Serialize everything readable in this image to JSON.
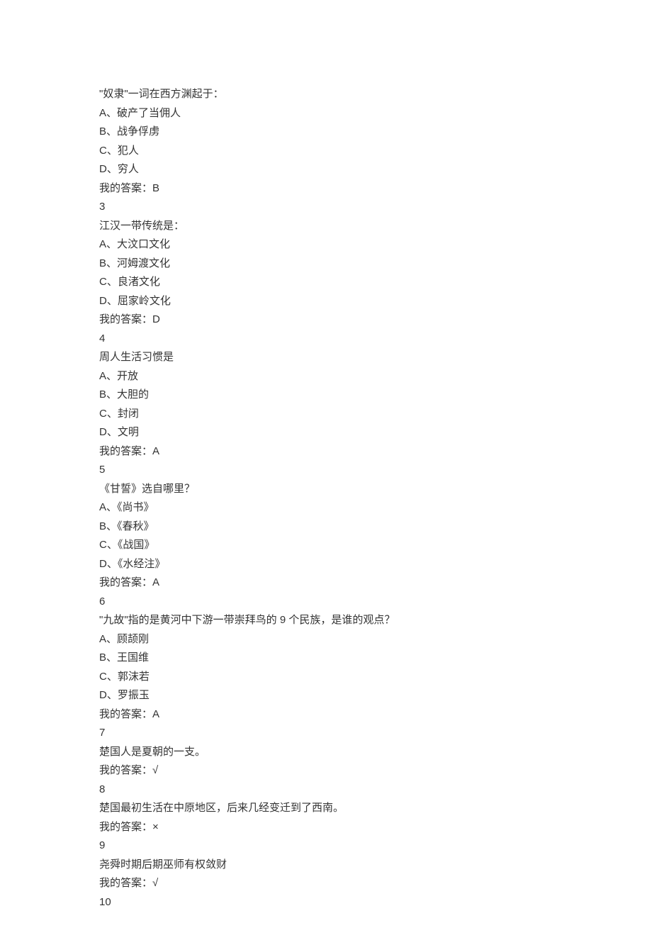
{
  "questions": [
    {
      "stem": "\"奴隶\"一词在西方渊起于：",
      "options": [
        "A、破产了当佣人",
        "B、战争俘虏",
        "C、犯人",
        "D、穷人"
      ],
      "myAnswer": "我的答案：B"
    },
    {
      "number": "3",
      "stem": "江汉一带传统是：",
      "options": [
        "A、大汶口文化",
        "B、河姆渡文化",
        "C、良渚文化",
        "D、屈家岭文化"
      ],
      "myAnswer": "我的答案：D"
    },
    {
      "number": "4",
      "stem": "周人生活习惯是",
      "options": [
        "A、开放",
        "B、大胆的",
        "C、封闭",
        "D、文明"
      ],
      "myAnswer": "我的答案：A"
    },
    {
      "number": "5",
      "stem": "《甘誓》选自哪里？",
      "options": [
        "A、《尚书》",
        "B、《春秋》",
        "C、《战国》",
        "D、《水经注》"
      ],
      "myAnswer": "我的答案：A"
    },
    {
      "number": "6",
      "stem": "\"九故\"指的是黄河中下游一带崇拜鸟的 9 个民族，是谁的观点？",
      "options": [
        "A、顾颉刚",
        "B、王国维",
        "C、郭沫若",
        "D、罗振玉"
      ],
      "myAnswer": "我的答案：A"
    },
    {
      "number": "7",
      "stem": "楚国人是夏朝的一支。",
      "myAnswer": "我的答案：√"
    },
    {
      "number": "8",
      "stem": "楚国最初生活在中原地区，后来几经变迁到了西南。",
      "myAnswer": "我的答案：×"
    },
    {
      "number": "9",
      "stem": "尧舜时期后期巫师有权敛财",
      "myAnswer": "我的答案：√"
    },
    {
      "number": "10"
    }
  ]
}
